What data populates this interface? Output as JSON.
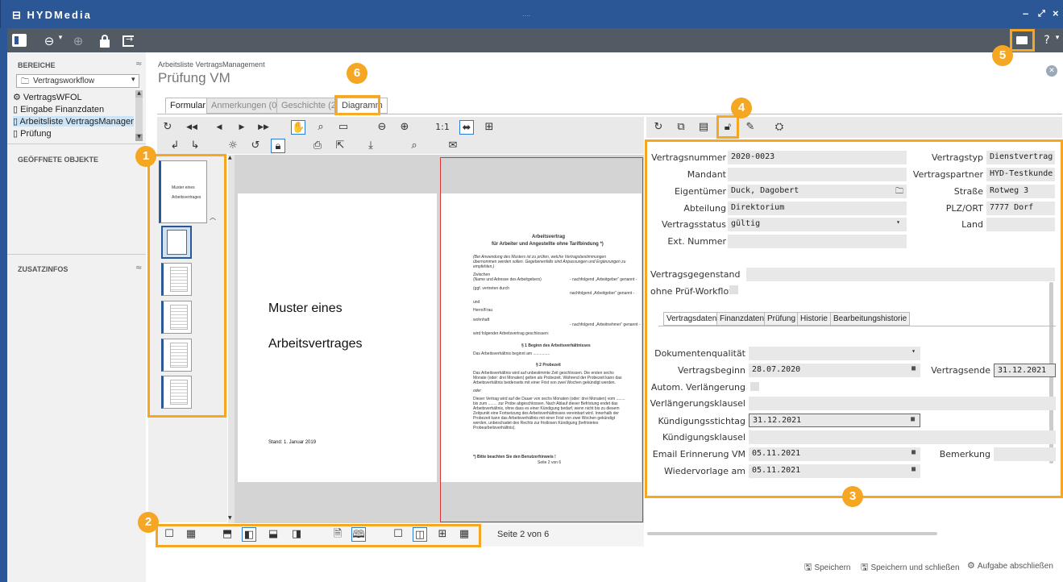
{
  "app": {
    "title": "HYDMedia",
    "minimize": "–",
    "restore": "⤢",
    "close": "×",
    "dotlabel": "...."
  },
  "toolbar": {
    "icons": [
      "sidebar-toggle-icon",
      "back-icon",
      "forward-icon",
      "lock-icon",
      "logout-icon",
      "mail-icon",
      "help-icon"
    ]
  },
  "sidebar": {
    "bereiche": "BEREICHE",
    "workflow_select": "Vertragsworkflow",
    "items": [
      {
        "label": "VertragsWFOL"
      },
      {
        "label": "Eingabe Finanzdaten"
      },
      {
        "label": "Arbeitsliste VertragsManagem"
      },
      {
        "label": "Prüfung"
      }
    ],
    "geoeffnete": "GEÖFFNETE OBJEKTE",
    "zusatzinfos": "ZUSATZINFOS"
  },
  "main": {
    "breadcrumb": "Arbeitsliste VertragsManagement",
    "title": "Prüfung VM",
    "tabs": [
      {
        "label": "Formular"
      },
      {
        "label": "Anmerkungen (0)"
      },
      {
        "label": "Geschichte (2)"
      },
      {
        "label": "Diagramm"
      }
    ]
  },
  "viewer": {
    "zoom_label": "1:1",
    "page_status": "Seite 2 von 6",
    "page1_title_line1": "Muster eines",
    "page1_title_line2": "Arbeitsvertrages",
    "page1_stand": "Stand: 1. Januar 2019",
    "thumb_title_line1": "Muster eines",
    "thumb_title_line2": "Arbeitsvertrages",
    "page2": {
      "heading1": "Arbeitsvertrag",
      "heading2": "für Arbeiter und Angestellte ohne Tarifbindung *)",
      "intro": "(Bei Anwendung des Musters ist zu prüfen, welche Vertragsbestimmungen übernommen werden sollen. Gegebenenfalls sind Anpassungen und Ergänzungen zu empfehlen.)",
      "zwischen": "Zwischen",
      "name_adresse": "(Name und Adresse des Arbeitgebers)",
      "arbeitgeber": "- nachfolgend „Arbeitgeber“ genannt -",
      "vertreten": "(ggf. vertreten durch",
      "arbeitgeber2": "nachfolgend „Arbeitgeber“ genannt -",
      "und": "und",
      "herr_frau": "Herrn/Frau",
      "wohnhaft": "wohnhaft",
      "arbeitnehmer": "- nachfolgend „Arbeitnehmer“ genannt -",
      "geschlossen": "wird folgender Arbeitsvertrag geschlossen:",
      "s1": "§ 1 Beginn des Arbeitsverhältnisses",
      "s1text": "Das Arbeitsverhältnis beginnt am ...............",
      "s2": "§ 2 Probezeit",
      "s2text": "Das Arbeitsverhältnis wird auf unbestimmte Zeit geschlossen. Die ersten sechs Monate (oder: drei Monaten) gelten als Probezeit. Während der Probezeit kann das Arbeitsverhältnis beiderseits mit einer Frist von zwei Wochen gekündigt werden.",
      "oder": "oder",
      "s2text2": "Dieser Vertrag wird auf die Dauer von sechs Monaten (oder: drei Monaten) vom ........ bis zum ........ zur Probe abgeschlossen. Nach Ablauf dieser Befristung endet das Arbeitsverhältnis, ohne dass es einer Kündigung bedarf, wenn nicht bis zu diesem Zeitpunkt eine Fortsetzung des Arbeitsverhältnisses vereinbart wird. Innerhalb der Probezeit kann das Arbeitsverhältnis mit einer Frist von zwei Wochen gekündigt werden, unbeschadet des Rechts zur fristlosen Kündigung (befristetes Probearbeitsverhältnis).",
      "footnote": "*)    Bitte    beachten    Sie    den    Benutzerhinweis    !",
      "pageno": "Seite 2 von 6"
    }
  },
  "form": {
    "vertragsnummer_label": "Vertragsnummer",
    "vertragsnummer": "2020-0023",
    "mandant_label": "Mandant",
    "eigentuemer_label": "Eigentümer",
    "eigentuemer": "Duck,  Dagobert",
    "abteilung_label": "Abteilung",
    "abteilung": "Direktorium",
    "vertragsstatus_label": "Vertragsstatus",
    "vertragsstatus": "gültig",
    "extnummer_label": "Ext. Nummer",
    "vertragstyp_label": "Vertragstyp",
    "vertragstyp": "Dienstvertrag",
    "vertragspartner_label": "Vertragspartner",
    "vertragspartner": "HYD-Testkunde",
    "strasse_label": "Straße",
    "strasse": "Rotweg 3",
    "plzort_label": "PLZ/ORT",
    "plzort": "7777 Dorf",
    "land_label": "Land",
    "gegenstand_label": "Vertragsgegenstand",
    "pruefworkflow_label": "ohne Prüf-Workflow",
    "subtabs": [
      {
        "label": "Vertragsdaten"
      },
      {
        "label": "Finanzdaten"
      },
      {
        "label": "Prüfung"
      },
      {
        "label": "Historie"
      },
      {
        "label": "Bearbeitungshistorie"
      }
    ],
    "dokqual_label": "Dokumentenqualität",
    "beginn_label": "Vertragsbeginn",
    "beginn": "28.07.2020",
    "ende_label": "Vertragsende",
    "ende": "31.12.2021",
    "autom_label": "Autom. Verlängerung",
    "klausel_label": "Verlängerungsklausel",
    "stichtag_label": "Kündigungsstichtag",
    "stichtag": "31.12.2021",
    "kklausel_label": "Kündigungsklausel",
    "email_label": "Email Erinnerung VM",
    "email": "05.11.2021",
    "bemerkung_label": "Bemerkung",
    "wiedervorlage_label": "Wiedervorlage am",
    "wiedervorlage": "05.11.2021"
  },
  "footer": {
    "save": "Speichern",
    "save_close": "Speichern und schließen",
    "finish": "Aufgabe abschließen"
  },
  "badges": [
    "1",
    "2",
    "3",
    "4",
    "5",
    "6"
  ],
  "colors": {
    "titlebar": "#2b5797",
    "toolbar": "#525a63",
    "highlight": "#f5a623",
    "selected": "#cce4f7"
  }
}
